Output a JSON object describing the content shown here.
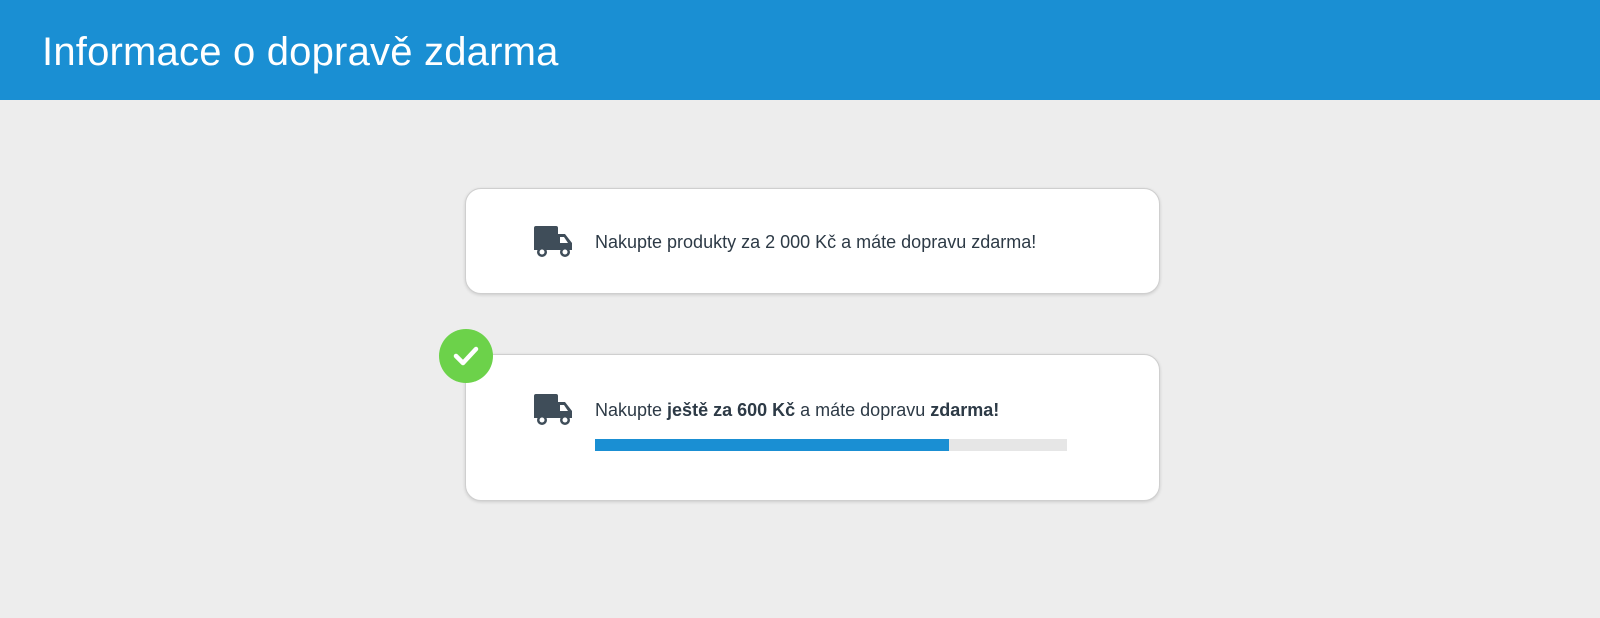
{
  "header": {
    "title": "Informace o dopravě zdarma",
    "color": "#1a8fd3"
  },
  "cards": [
    {
      "icon": "truck-icon",
      "message": "Nakupte produkty za 2 000 Kč a máte dopravu zdarma!"
    },
    {
      "icon": "truck-icon",
      "badge_icon": "checkmark-icon",
      "message_prefix": "Nakupte ",
      "message_bold_1": "ještě za 600 Kč",
      "message_middle": " a máte dopravu ",
      "message_bold_2": "zdarma!",
      "progress_percent": 75,
      "progress_color": "#1a8fd3",
      "badge_color": "#6cd24a"
    }
  ]
}
